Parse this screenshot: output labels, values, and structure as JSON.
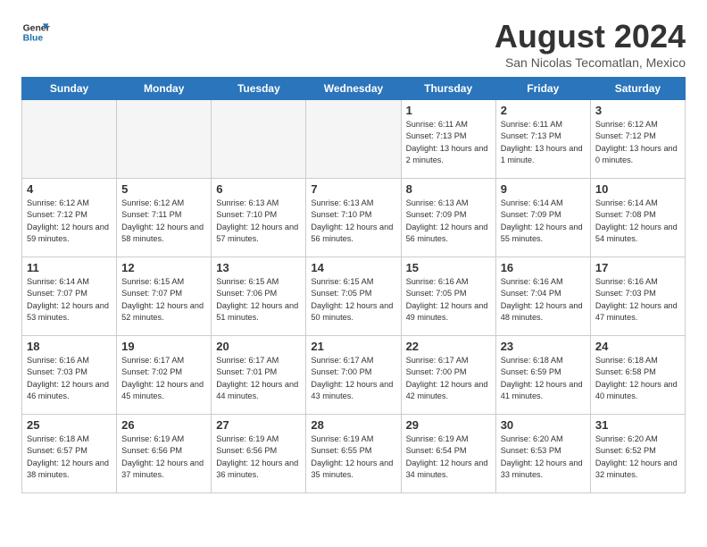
{
  "header": {
    "logo_line1": "General",
    "logo_line2": "Blue",
    "month_title": "August 2024",
    "subtitle": "San Nicolas Tecomatlan, Mexico"
  },
  "days_of_week": [
    "Sunday",
    "Monday",
    "Tuesday",
    "Wednesday",
    "Thursday",
    "Friday",
    "Saturday"
  ],
  "weeks": [
    [
      {
        "day": "",
        "empty": true
      },
      {
        "day": "",
        "empty": true
      },
      {
        "day": "",
        "empty": true
      },
      {
        "day": "",
        "empty": true
      },
      {
        "day": "1",
        "sunrise": "6:11 AM",
        "sunset": "7:13 PM",
        "daylight": "13 hours and 2 minutes."
      },
      {
        "day": "2",
        "sunrise": "6:11 AM",
        "sunset": "7:13 PM",
        "daylight": "13 hours and 1 minute."
      },
      {
        "day": "3",
        "sunrise": "6:12 AM",
        "sunset": "7:12 PM",
        "daylight": "13 hours and 0 minutes."
      }
    ],
    [
      {
        "day": "4",
        "sunrise": "6:12 AM",
        "sunset": "7:12 PM",
        "daylight": "12 hours and 59 minutes."
      },
      {
        "day": "5",
        "sunrise": "6:12 AM",
        "sunset": "7:11 PM",
        "daylight": "12 hours and 58 minutes."
      },
      {
        "day": "6",
        "sunrise": "6:13 AM",
        "sunset": "7:10 PM",
        "daylight": "12 hours and 57 minutes."
      },
      {
        "day": "7",
        "sunrise": "6:13 AM",
        "sunset": "7:10 PM",
        "daylight": "12 hours and 56 minutes."
      },
      {
        "day": "8",
        "sunrise": "6:13 AM",
        "sunset": "7:09 PM",
        "daylight": "12 hours and 56 minutes."
      },
      {
        "day": "9",
        "sunrise": "6:14 AM",
        "sunset": "7:09 PM",
        "daylight": "12 hours and 55 minutes."
      },
      {
        "day": "10",
        "sunrise": "6:14 AM",
        "sunset": "7:08 PM",
        "daylight": "12 hours and 54 minutes."
      }
    ],
    [
      {
        "day": "11",
        "sunrise": "6:14 AM",
        "sunset": "7:07 PM",
        "daylight": "12 hours and 53 minutes."
      },
      {
        "day": "12",
        "sunrise": "6:15 AM",
        "sunset": "7:07 PM",
        "daylight": "12 hours and 52 minutes."
      },
      {
        "day": "13",
        "sunrise": "6:15 AM",
        "sunset": "7:06 PM",
        "daylight": "12 hours and 51 minutes."
      },
      {
        "day": "14",
        "sunrise": "6:15 AM",
        "sunset": "7:05 PM",
        "daylight": "12 hours and 50 minutes."
      },
      {
        "day": "15",
        "sunrise": "6:16 AM",
        "sunset": "7:05 PM",
        "daylight": "12 hours and 49 minutes."
      },
      {
        "day": "16",
        "sunrise": "6:16 AM",
        "sunset": "7:04 PM",
        "daylight": "12 hours and 48 minutes."
      },
      {
        "day": "17",
        "sunrise": "6:16 AM",
        "sunset": "7:03 PM",
        "daylight": "12 hours and 47 minutes."
      }
    ],
    [
      {
        "day": "18",
        "sunrise": "6:16 AM",
        "sunset": "7:03 PM",
        "daylight": "12 hours and 46 minutes."
      },
      {
        "day": "19",
        "sunrise": "6:17 AM",
        "sunset": "7:02 PM",
        "daylight": "12 hours and 45 minutes."
      },
      {
        "day": "20",
        "sunrise": "6:17 AM",
        "sunset": "7:01 PM",
        "daylight": "12 hours and 44 minutes."
      },
      {
        "day": "21",
        "sunrise": "6:17 AM",
        "sunset": "7:00 PM",
        "daylight": "12 hours and 43 minutes."
      },
      {
        "day": "22",
        "sunrise": "6:17 AM",
        "sunset": "7:00 PM",
        "daylight": "12 hours and 42 minutes."
      },
      {
        "day": "23",
        "sunrise": "6:18 AM",
        "sunset": "6:59 PM",
        "daylight": "12 hours and 41 minutes."
      },
      {
        "day": "24",
        "sunrise": "6:18 AM",
        "sunset": "6:58 PM",
        "daylight": "12 hours and 40 minutes."
      }
    ],
    [
      {
        "day": "25",
        "sunrise": "6:18 AM",
        "sunset": "6:57 PM",
        "daylight": "12 hours and 38 minutes."
      },
      {
        "day": "26",
        "sunrise": "6:19 AM",
        "sunset": "6:56 PM",
        "daylight": "12 hours and 37 minutes."
      },
      {
        "day": "27",
        "sunrise": "6:19 AM",
        "sunset": "6:56 PM",
        "daylight": "12 hours and 36 minutes."
      },
      {
        "day": "28",
        "sunrise": "6:19 AM",
        "sunset": "6:55 PM",
        "daylight": "12 hours and 35 minutes."
      },
      {
        "day": "29",
        "sunrise": "6:19 AM",
        "sunset": "6:54 PM",
        "daylight": "12 hours and 34 minutes."
      },
      {
        "day": "30",
        "sunrise": "6:20 AM",
        "sunset": "6:53 PM",
        "daylight": "12 hours and 33 minutes."
      },
      {
        "day": "31",
        "sunrise": "6:20 AM",
        "sunset": "6:52 PM",
        "daylight": "12 hours and 32 minutes."
      }
    ]
  ]
}
